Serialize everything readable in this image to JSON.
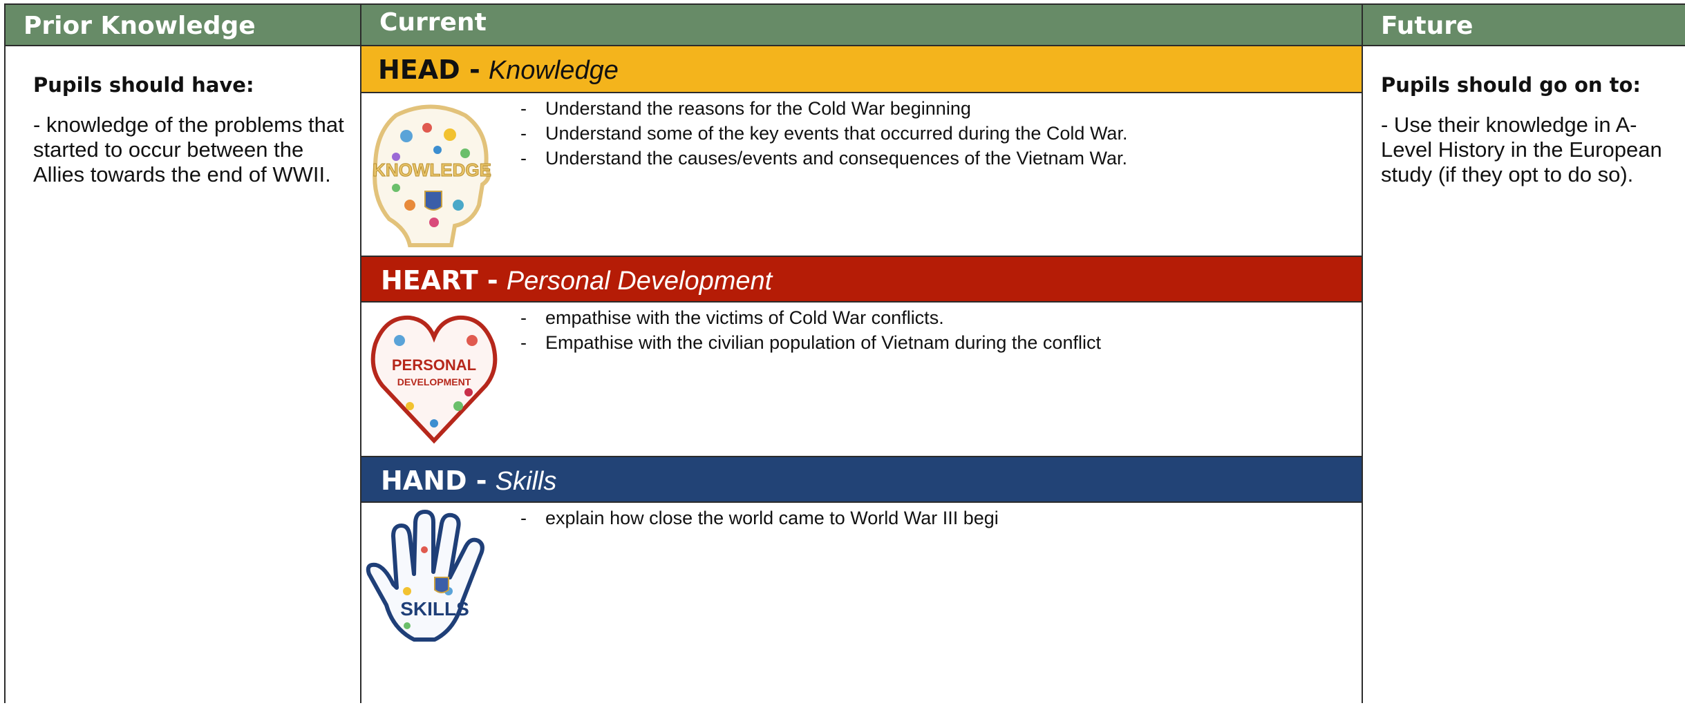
{
  "columns": {
    "prior": {
      "header": "Prior Knowledge",
      "heading": "Pupils should have:",
      "text": "- knowledge of the problems that started to occur between the Allies towards the end of WWII."
    },
    "current": {
      "header": "Current"
    },
    "future": {
      "header": "Future",
      "heading": "Pupils should go on to:",
      "text": "- Use their knowledge in A-Level History in the European study (if they opt to do so)."
    }
  },
  "sections": {
    "head": {
      "title": "HEAD -",
      "subtitle": "Knowledge",
      "icon_label": "KNOWLEDGE",
      "bullets": [
        "Understand the reasons for the Cold War beginning",
        "Understand some of the key events that occurred during the Cold War.",
        "Understand the causes/events and consequences of the Vietnam War."
      ]
    },
    "heart": {
      "title": "HEART -",
      "subtitle": "Personal Development",
      "icon_label_1": "PERSONAL",
      "icon_label_2": "DEVELOPMENT",
      "bullets": [
        "empathise with the victims of Cold War conflicts.",
        "Empathise with the civilian population of Vietnam during the conflict"
      ]
    },
    "hand": {
      "title": "HAND -",
      "subtitle": "Skills",
      "icon_label": "SKILLS",
      "bullets": [
        "explain how close the world came to World War III begi"
      ]
    }
  },
  "colors": {
    "header_green": "#678b67",
    "head_yellow": "#f4b41c",
    "heart_red": "#b51c06",
    "hand_blue": "#224376"
  },
  "icons": [
    "knowledge-head-icon",
    "personal-development-heart-icon",
    "skills-hand-icon"
  ]
}
